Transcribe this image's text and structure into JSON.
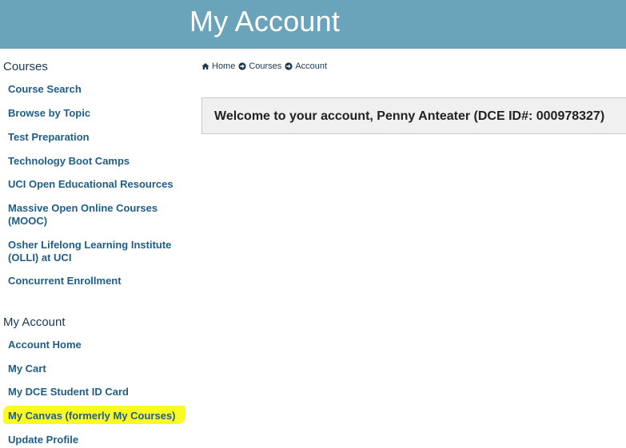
{
  "header": {
    "title": "My Account"
  },
  "sidebar": {
    "courses_heading": "Courses",
    "courses_links": [
      "Course Search",
      "Browse by Topic",
      "Test Preparation",
      "Technology Boot Camps",
      "UCI Open Educational Resources",
      "Massive Open Online Courses (MOOC)",
      "Osher Lifelong Learning Institute (OLLI) at UCI",
      "Concurrent Enrollment"
    ],
    "account_heading": "My Account",
    "account_links": [
      "Account Home",
      "My Cart",
      "My DCE Student ID Card",
      "My Canvas (formerly My Courses)",
      "Update Profile"
    ]
  },
  "breadcrumb": {
    "items": [
      {
        "label": "Home",
        "icon": "home-icon"
      },
      {
        "label": "Courses",
        "icon": "arrow-circle-right-icon"
      },
      {
        "label": "Account",
        "icon": "arrow-circle-right-icon"
      }
    ]
  },
  "main": {
    "welcome": "Welcome to your account, Penny Anteater (DCE ID#: 000978327)"
  },
  "colors": {
    "header_bg": "#6aa4bb",
    "link": "#1d5e88",
    "highlight": "#fbfb22"
  }
}
